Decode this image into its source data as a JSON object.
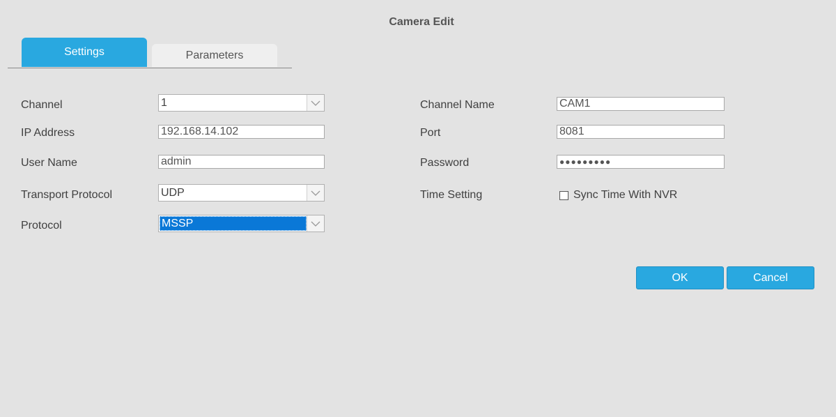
{
  "dialog": {
    "title": "Camera Edit"
  },
  "tabs": [
    {
      "label": "Settings",
      "active": true
    },
    {
      "label": "Parameters",
      "active": false
    }
  ],
  "form": {
    "channel": {
      "label": "Channel",
      "value": "1"
    },
    "ip_address": {
      "label": "IP Address",
      "value": "192.168.14.102"
    },
    "user_name": {
      "label": "User Name",
      "value": "admin"
    },
    "transport_protocol": {
      "label": "Transport Protocol",
      "value": "UDP"
    },
    "protocol": {
      "label": "Protocol",
      "value": "MSSP"
    },
    "channel_name": {
      "label": "Channel Name",
      "value": "CAM1"
    },
    "port": {
      "label": "Port",
      "value": "8081"
    },
    "password": {
      "label": "Password",
      "value": "●●●●●●●●●"
    },
    "time_setting": {
      "label": "Time Setting",
      "checkbox_label": "Sync Time With NVR",
      "checked": false
    }
  },
  "buttons": {
    "ok": "OK",
    "cancel": "Cancel"
  },
  "colors": {
    "accent": "#29a8e0",
    "selection": "#0a78d7",
    "background": "#e3e3e3"
  }
}
